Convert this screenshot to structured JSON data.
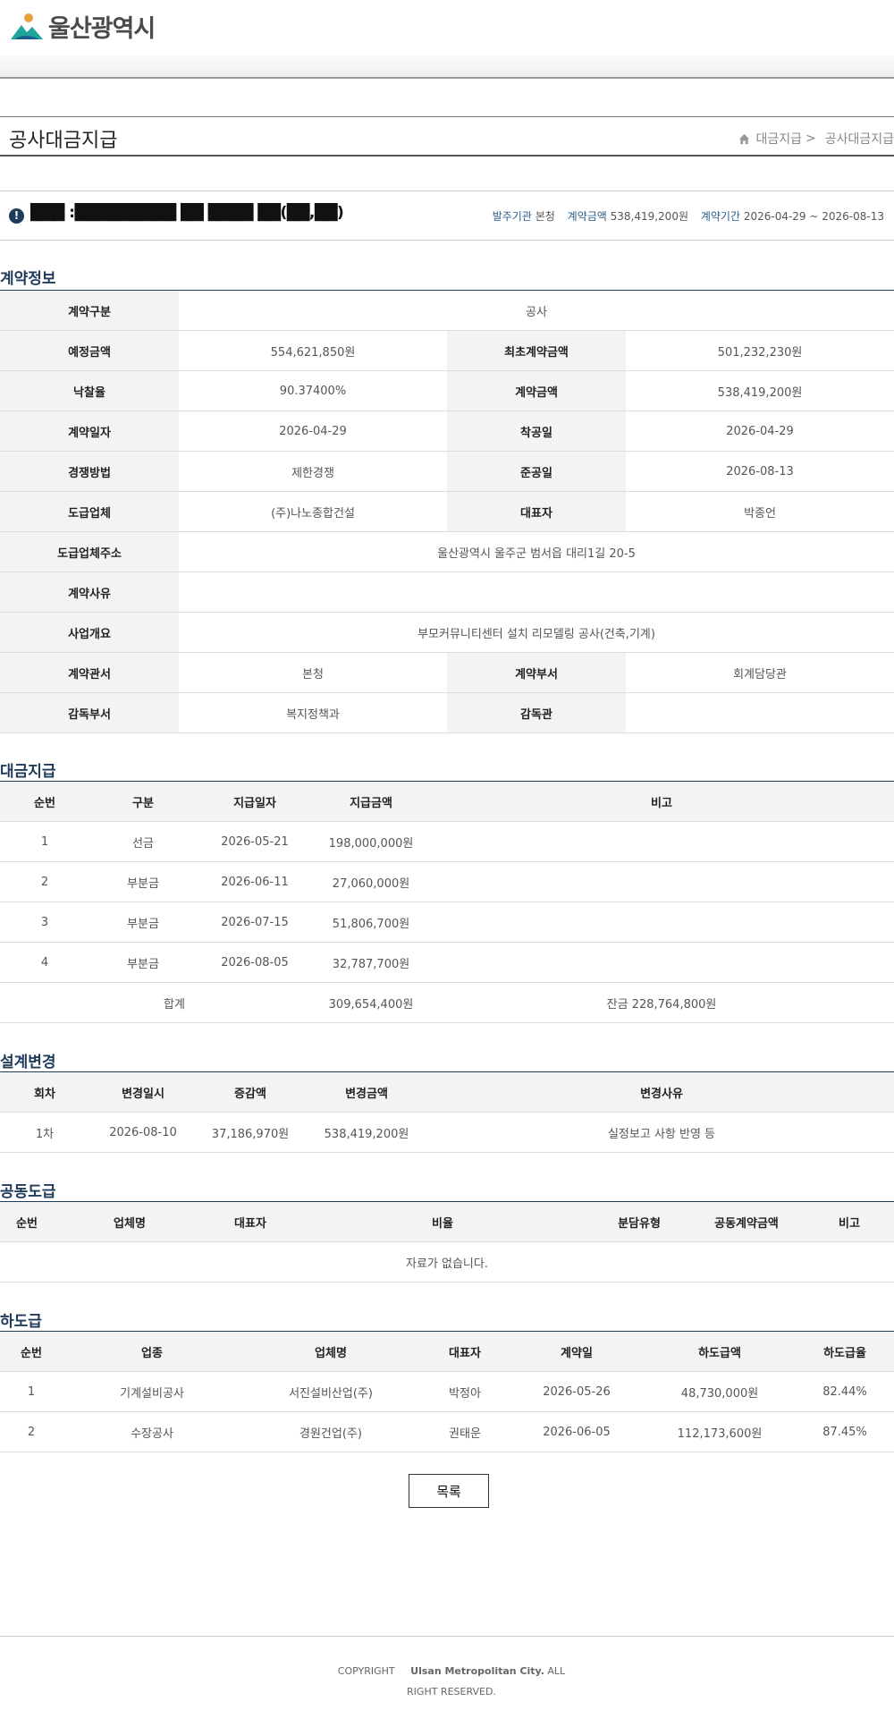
{
  "header": {
    "logo_text": "울산광역시"
  },
  "page": {
    "title": "공사대금지급",
    "breadcrumb": [
      "대금지급",
      "공사대금지급"
    ],
    "breadcrumb_sep": ">"
  },
  "summary": {
    "project_name": "███ :█████████ ██ ████ ██(██,██)",
    "agency_label": "발주기관",
    "agency_value": "본청",
    "amount_label": "계약금액",
    "amount_value": "538,419,200원",
    "period_label": "계약기간",
    "period_value": "2026-04-29 ~ 2026-08-13"
  },
  "contract_info": {
    "title": "계약정보",
    "rows": [
      {
        "type": "full",
        "label": "계약구분",
        "value": "공사"
      },
      {
        "type": "pair",
        "label1": "예정금액",
        "value1": "554,621,850원",
        "label2": "최초계약금액",
        "value2": "501,232,230원"
      },
      {
        "type": "pair",
        "label1": "낙찰율",
        "value1": "90.37400%",
        "label2": "계약금액",
        "value2": "538,419,200원"
      },
      {
        "type": "pair",
        "label1": "계약일자",
        "value1": "2026-04-29",
        "label2": "착공일",
        "value2": "2026-04-29"
      },
      {
        "type": "pair",
        "label1": "경쟁방법",
        "value1": "제한경쟁",
        "label2": "준공일",
        "value2": "2026-08-13"
      },
      {
        "type": "pair",
        "label1": "도급업체",
        "value1": "(주)나노종합건설",
        "label2": "대표자",
        "value2": "박종언"
      },
      {
        "type": "full",
        "label": "도급업체주소",
        "value": "울산광역시 울주군 범서읍 대리1길 20-5"
      },
      {
        "type": "full",
        "label": "계약사유",
        "value": ""
      },
      {
        "type": "full",
        "label": "사업개요",
        "value": "부모커뮤니티센터 설치 리모델링 공사(건축,기계)"
      },
      {
        "type": "pair",
        "label1": "계약관서",
        "value1": "본청",
        "label2": "계약부서",
        "value2": "회계담당관"
      },
      {
        "type": "pair",
        "label1": "감독부서",
        "value1": "복지정책과",
        "label2": "감독관",
        "value2": ""
      }
    ]
  },
  "payments": {
    "title": "대금지급",
    "headers": [
      "순번",
      "구분",
      "지급일자",
      "지급금액",
      "비고"
    ],
    "rows": [
      [
        "1",
        "선금",
        "2026-05-21",
        "198,000,000원",
        ""
      ],
      [
        "2",
        "부분금",
        "2026-06-11",
        "27,060,000원",
        ""
      ],
      [
        "3",
        "부분금",
        "2026-07-15",
        "51,806,700원",
        ""
      ],
      [
        "4",
        "부분금",
        "2026-08-05",
        "32,787,700원",
        ""
      ]
    ],
    "total_label": "합계",
    "total_value": "309,654,400원",
    "balance": "잔금 228,764,800원"
  },
  "design_change": {
    "title": "설계변경",
    "headers": [
      "회차",
      "변경일시",
      "증감액",
      "변경금액",
      "변경사유"
    ],
    "rows": [
      [
        "1차",
        "2026-08-10",
        "37,186,970원",
        "538,419,200원",
        "실정보고 사항 반영 등"
      ]
    ]
  },
  "joint_contract": {
    "title": "공동도급",
    "headers": [
      "순번",
      "업체명",
      "대표자",
      "비율",
      "분담유형",
      "공동계약금액",
      "비고"
    ],
    "empty": "자료가 없습니다."
  },
  "subcontract": {
    "title": "하도급",
    "headers": [
      "순번",
      "업종",
      "업체명",
      "대표자",
      "계약일",
      "하도급액",
      "하도급율"
    ],
    "rows": [
      [
        "1",
        "기계설비공사",
        "서진설비산업(주)",
        "박정아",
        "2026-05-26",
        "48,730,000원",
        "82.44%"
      ],
      [
        "2",
        "수장공사",
        "경원건업(주)",
        "권태운",
        "2026-06-05",
        "112,173,600원",
        "87.45%"
      ]
    ]
  },
  "list_button": "목록",
  "footer": {
    "copyright": "COPYRIGHT",
    "org": "Ulsan Metropolitan City.",
    "rights": "ALL RIGHT RESERVED."
  },
  "colors": {
    "accent": "#1f3b5a",
    "header_bg": "#f2f4f3",
    "logo_teal": "#1fa59a"
  }
}
